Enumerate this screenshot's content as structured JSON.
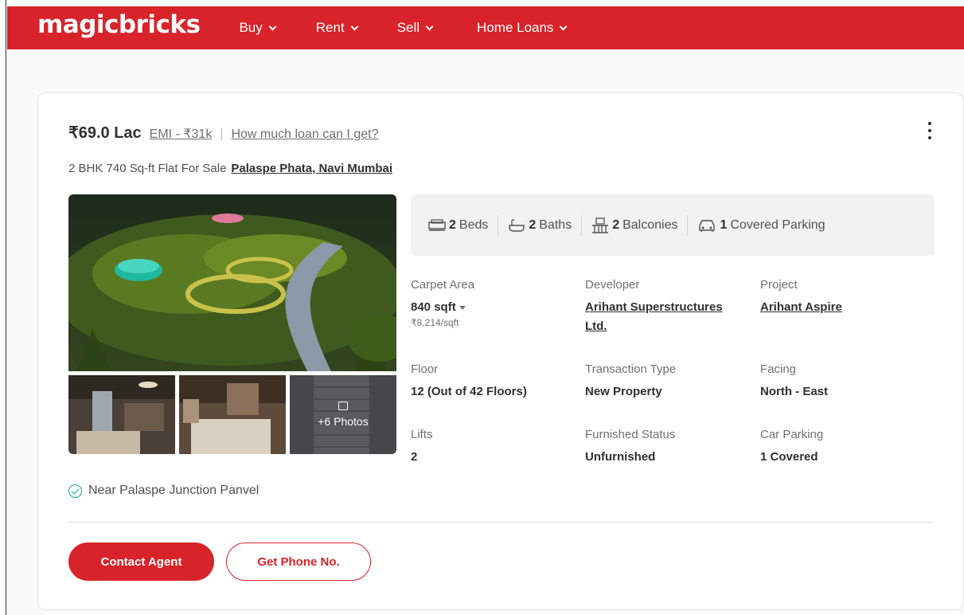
{
  "nav": {
    "logo": "magicbricks",
    "items": [
      {
        "label": "Buy"
      },
      {
        "label": "Rent"
      },
      {
        "label": "Sell"
      },
      {
        "label": "Home Loans"
      }
    ]
  },
  "listing": {
    "price": "₹69.0 Lac",
    "emi": "EMI - ₹31k",
    "separator": "|",
    "loan_link": "How much loan can I get?",
    "title": "2 BHK 740 Sq-ft Flat For Sale",
    "locality": "Palaspe Phata, Navi Mumbai",
    "more_photos": "+6 Photos",
    "amenities": [
      {
        "value": "2",
        "label": "Beds",
        "icon": "bed-icon"
      },
      {
        "value": "2",
        "label": "Baths",
        "icon": "bath-icon"
      },
      {
        "value": "2",
        "label": "Balconies",
        "icon": "balcony-icon"
      },
      {
        "value": "1",
        "label": "Covered Parking",
        "icon": "car-icon"
      }
    ],
    "details": {
      "carpet_area": {
        "label": "Carpet Area",
        "value": "840 sqft",
        "sub": "₹8,214/sqft"
      },
      "developer": {
        "label": "Developer",
        "value": "Arihant Superstructures Ltd."
      },
      "project": {
        "label": "Project",
        "value": "Arihant Aspire"
      },
      "floor": {
        "label": "Floor",
        "value": "12 (Out of 42 Floors)"
      },
      "transaction": {
        "label": "Transaction Type",
        "value": "New Property"
      },
      "facing": {
        "label": "Facing",
        "value": "North - East"
      },
      "lifts": {
        "label": "Lifts",
        "value": "2"
      },
      "furnished": {
        "label": "Furnished Status",
        "value": "Unfurnished"
      },
      "car_parking": {
        "label": "Car Parking",
        "value": "1 Covered"
      }
    },
    "landmark": "Near Palaspe Junction Panvel",
    "contact_button": "Contact Agent",
    "phone_button": "Get Phone No."
  },
  "colors": {
    "brand": "#d8232a",
    "check": "#1aa683"
  }
}
